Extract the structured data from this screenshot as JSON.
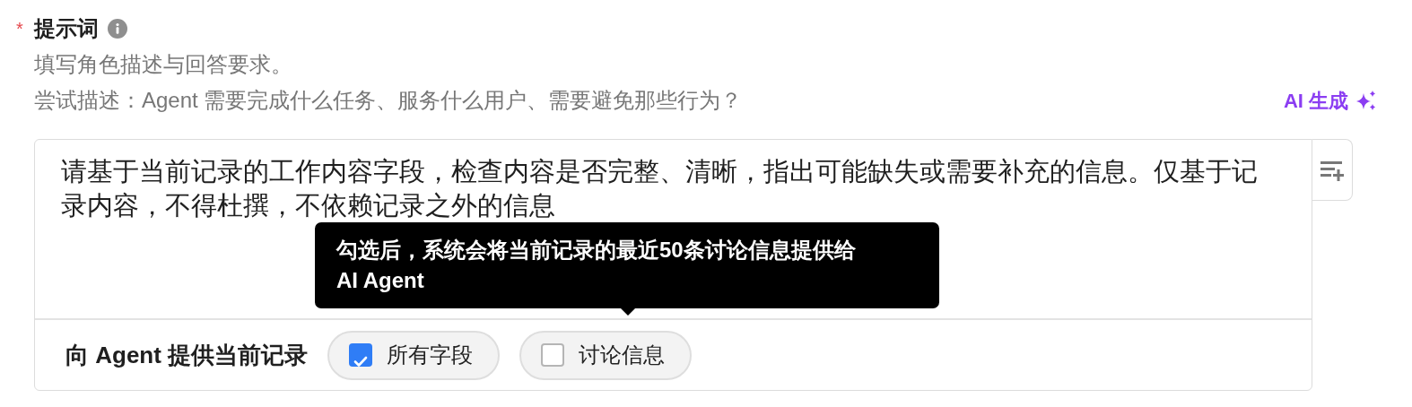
{
  "field": {
    "required_mark": "*",
    "label": "提示词",
    "description": "填写角色描述与回答要求。",
    "hint": "尝试描述：Agent 需要完成什么任务、服务什么用户、需要避免那些行为？",
    "ai_button": "AI 生成"
  },
  "editor": {
    "value": "请基于当前记录的工作内容字段，检查内容是否完整、清晰，指出可能缺失或需要补充的信息。仅基于记录内容，不得杜撰，不依赖记录之外的信息"
  },
  "tooltip": {
    "lines": [
      "勾选后，系统会将当前记录的最近50条讨论信息提供给",
      "AI Agent"
    ]
  },
  "footer": {
    "label": "向 Agent 提供当前记录",
    "options": [
      {
        "label": "所有字段",
        "checked": true
      },
      {
        "label": "讨论信息",
        "checked": false
      }
    ]
  }
}
